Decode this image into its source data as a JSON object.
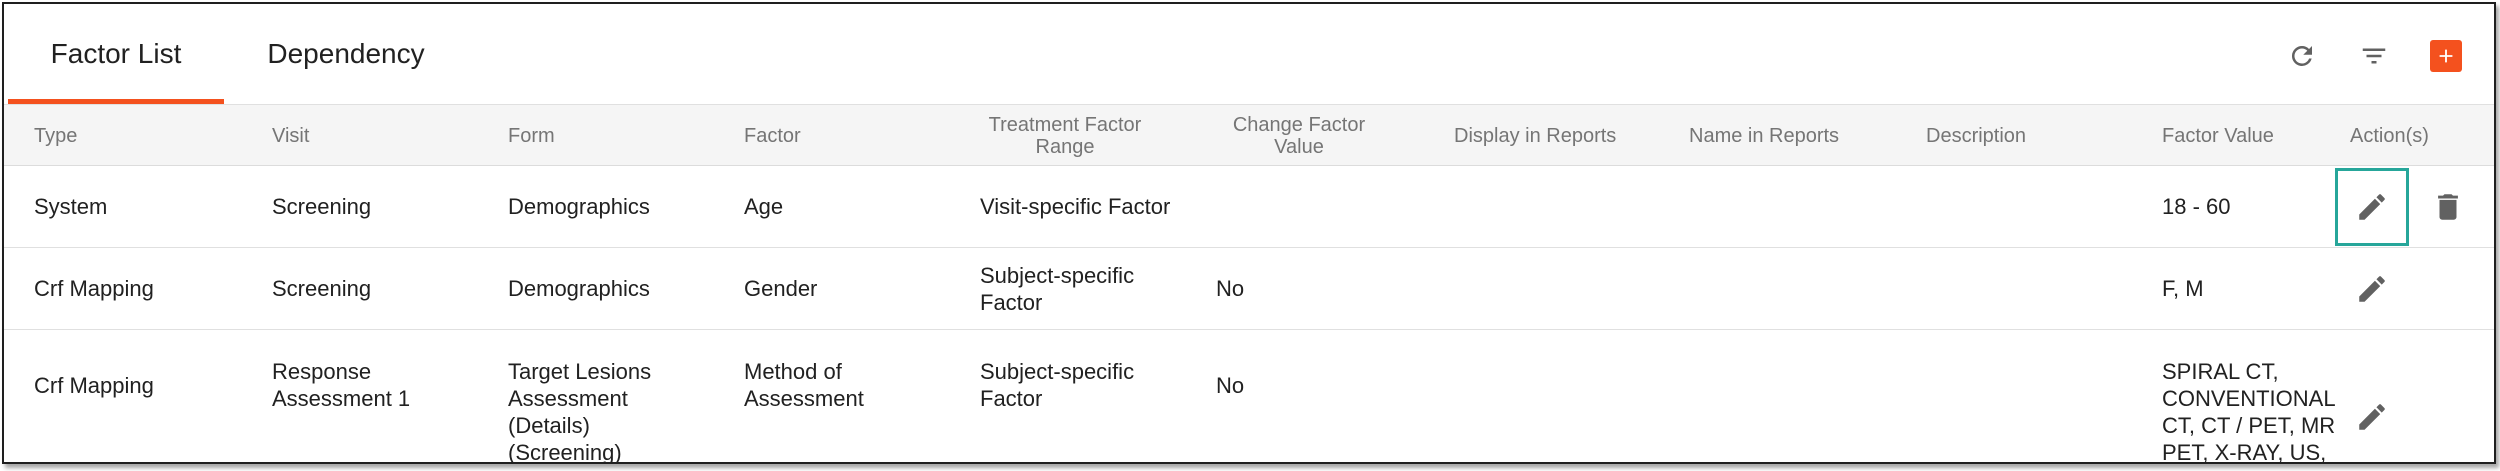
{
  "tabs": [
    {
      "label": "Factor List",
      "active": true
    },
    {
      "label": "Dependency",
      "active": false
    }
  ],
  "toolbar": {
    "refresh_icon": "refresh-icon",
    "filter_icon": "filter-icon",
    "add_icon": "plus-icon",
    "accent_color": "#f4511e"
  },
  "table": {
    "headers": [
      "Type",
      "Visit",
      "Form",
      "Factor",
      "Treatment Factor Range",
      "Change Factor Value",
      "Display in Reports",
      "Name in Reports",
      "Description",
      "Factor Value",
      "Action(s)"
    ],
    "rows": [
      {
        "type": "System",
        "visit": "Screening",
        "form": "Demographics",
        "factor": "Age",
        "range": "Visit-specific Factor",
        "change": "",
        "display": "",
        "name": "",
        "description": "",
        "value": "18 - 60",
        "actions": [
          "edit-icon",
          "delete-icon"
        ]
      },
      {
        "type": "Crf Mapping",
        "visit": "Screening",
        "form": "Demographics",
        "factor": "Gender",
        "range": "Subject-specific Factor",
        "change": "No",
        "display": "",
        "name": "",
        "description": "",
        "value": "F, M",
        "actions": [
          "edit-icon"
        ]
      },
      {
        "type": "Crf Mapping",
        "visit": "Response Assessment 1",
        "form": "Target Lesions Assessment (Details) (Screening)",
        "factor": "Method of Assessment",
        "range": "Subject-specific Factor",
        "change": "No",
        "display": "",
        "name": "",
        "description": "",
        "value": "SPIRAL CT, CONVENTIONAL CT, CT / PET, MR PET, X-RAY, US, OTH",
        "actions": [
          "edit-icon"
        ]
      }
    ]
  },
  "highlight_color": "#26a69a"
}
